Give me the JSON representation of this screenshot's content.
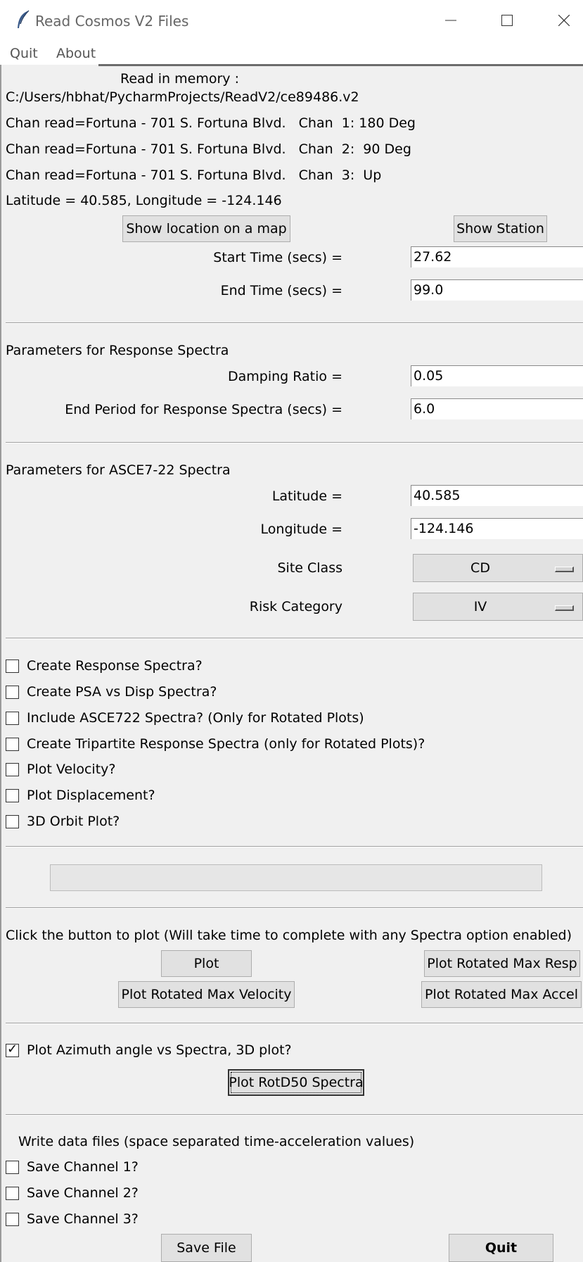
{
  "window": {
    "title": "Read Cosmos V2 Files",
    "menu": [
      "Quit",
      "About"
    ]
  },
  "info": {
    "read_in_memory_label": "Read in memory :",
    "file_path": "C:/Users/hbhat/PycharmProjects/ReadV2/ce89486.v2",
    "channels": [
      "Chan read=Fortuna - 701 S. Fortuna Blvd.   Chan  1: 180 Deg",
      "Chan read=Fortuna - 701 S. Fortuna Blvd.   Chan  2:  90 Deg",
      "Chan read=Fortuna - 701 S. Fortuna Blvd.   Chan  3:  Up"
    ],
    "lat_lon": "Latitude = 40.585, Longitude = -124.146"
  },
  "buttons": {
    "show_location": "Show location on a map",
    "show_station": "Show Station",
    "plot": "Plot",
    "plot_rotated_max_resp": "Plot Rotated Max Resp",
    "plot_rotated_max_velocity": "Plot Rotated Max Velocity",
    "plot_rotated_max_accel": "Plot Rotated Max Accel",
    "plot_rotd50": "Plot RotD50 Spectra",
    "save_file": "Save File",
    "quit": "Quit"
  },
  "time": {
    "start_label": "Start Time (secs) =",
    "start_value": "27.62",
    "end_label": "End Time (secs) =",
    "end_value": "99.0"
  },
  "response": {
    "heading": "Parameters for Response Spectra",
    "damping_label": "Damping Ratio =",
    "damping_value": "0.05",
    "end_period_label": "End Period for Response Spectra (secs) =",
    "end_period_value": "6.0"
  },
  "asce": {
    "heading": "Parameters for ASCE7-22 Spectra",
    "latitude_label": "Latitude =",
    "latitude_value": "40.585",
    "longitude_label": "Longitude =",
    "longitude_value": "-124.146",
    "site_class_label": "Site Class",
    "site_class_value": "CD",
    "risk_label": "Risk Category",
    "risk_value": "IV"
  },
  "options": [
    {
      "label": "Create Response Spectra?",
      "checked": false
    },
    {
      "label": "Create PSA vs Disp Spectra?",
      "checked": false
    },
    {
      "label": "Include ASCE722 Spectra? (Only for Rotated Plots)",
      "checked": false
    },
    {
      "label": "Create Tripartite Response Spectra (only for Rotated Plots)?",
      "checked": false
    },
    {
      "label": "Plot Velocity?",
      "checked": false
    },
    {
      "label": "Plot Displacement?",
      "checked": false
    },
    {
      "label": "3D Orbit Plot?",
      "checked": false
    }
  ],
  "plot_section": {
    "instruction": "Click the button to plot (Will take time to complete with any Spectra option enabled)"
  },
  "azimuth": {
    "label": "Plot Azimuth angle vs Spectra, 3D plot?",
    "checked": true
  },
  "write_section": {
    "heading": "Write data files (space separated time-acceleration values)",
    "channels": [
      {
        "label": "Save Channel 1?",
        "checked": false
      },
      {
        "label": "Save Channel 2?",
        "checked": false
      },
      {
        "label": "Save Channel 3?",
        "checked": false
      }
    ]
  }
}
